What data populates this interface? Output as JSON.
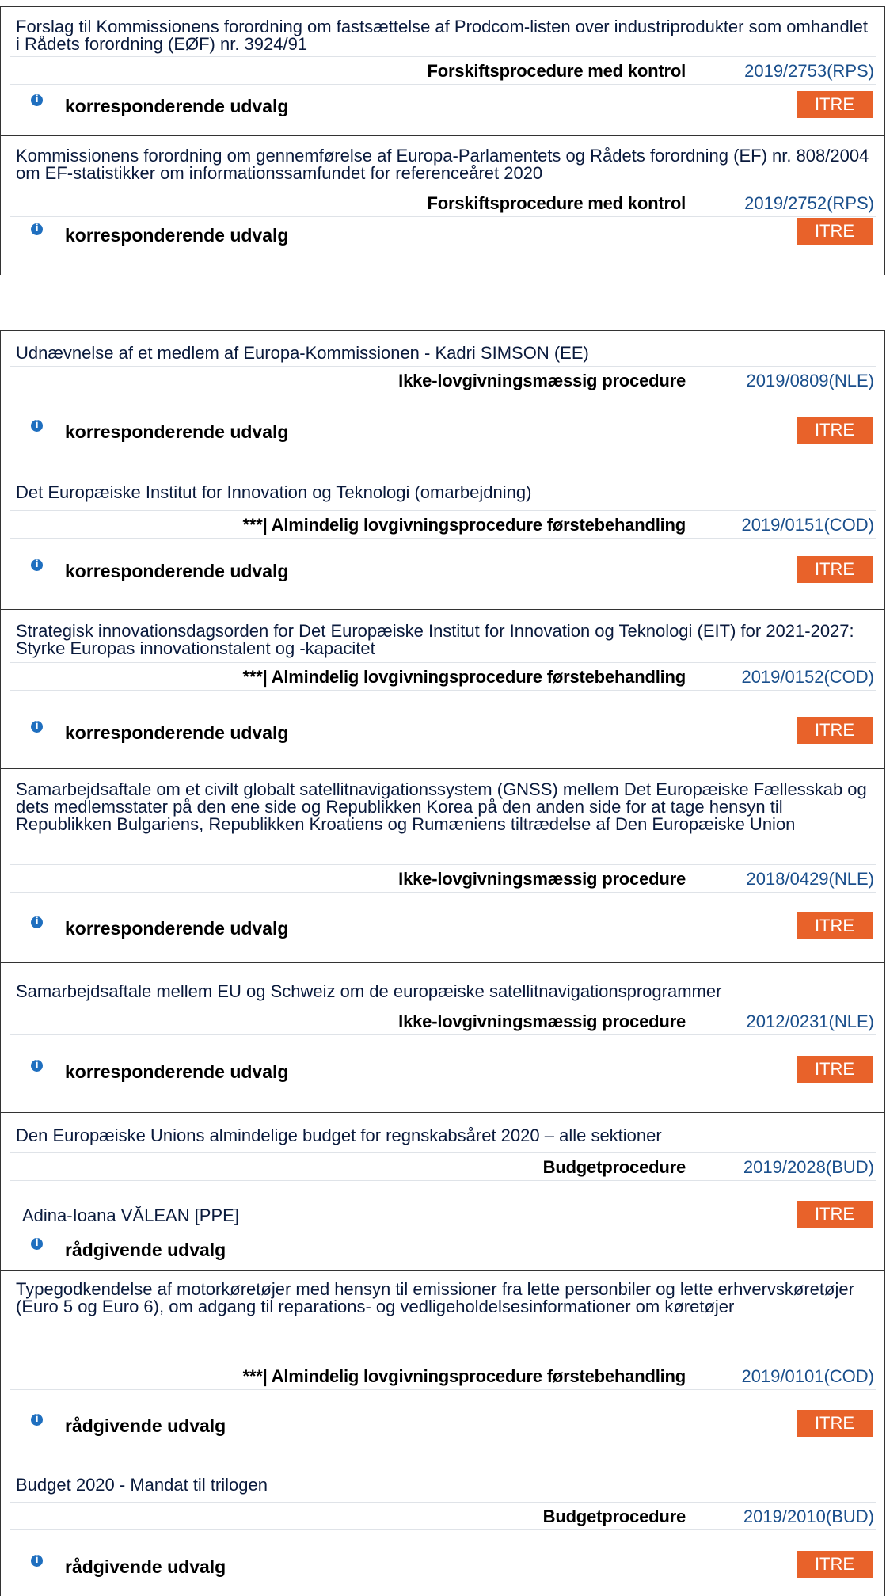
{
  "entries": [
    {
      "title": "Forslag til Kommissionens forordning om fastsættelse af Prodcom-listen over industriprodukter som omhandlet i Rådets forordning (EØF) nr. 3924/91",
      "procedure_type": "Forskiftsprocedure med kontrol",
      "procedure_ref": "2019/2753(RPS)",
      "rapporteur": "",
      "role": "korresponderende udvalg",
      "committee": "ITRE"
    },
    {
      "title": "Kommissionens forordning om gennemførelse af Europa-Parlamentets og Rådets forordning (EF) nr. 808/2004 om EF-statistikker om informationssamfundet for referenceåret 2020",
      "procedure_type": "Forskiftsprocedure med kontrol",
      "procedure_ref": "2019/2752(RPS)",
      "rapporteur": "",
      "role": "korresponderende udvalg",
      "committee": "ITRE"
    },
    {
      "title": "Udnævnelse af et medlem af Europa-Kommissionen - Kadri SIMSON  (EE)",
      "procedure_type": "Ikke-lovgivningsmæssig procedure",
      "procedure_ref": "2019/0809(NLE)",
      "rapporteur": "",
      "role": "korresponderende udvalg",
      "committee": "ITRE"
    },
    {
      "title": "Det Europæiske Institut for Innovation og Teknologi (omarbejdning)",
      "procedure_type": "***| Almindelig lovgivningsprocedure førstebehandling",
      "procedure_ref": "2019/0151(COD)",
      "rapporteur": "",
      "role": "korresponderende udvalg",
      "committee": "ITRE"
    },
    {
      "title": "Strategisk innovationsdagsorden for Det Europæiske Institut for Innovation og Teknologi (EIT) for 2021-2027: Styrke Europas innovationstalent og -kapacitet",
      "procedure_type": "***| Almindelig lovgivningsprocedure førstebehandling",
      "procedure_ref": "2019/0152(COD)",
      "rapporteur": "",
      "role": "korresponderende udvalg",
      "committee": "ITRE"
    },
    {
      "title": "Samarbejdsaftale om et civilt globalt satellitnavigationssystem (GNSS) mellem Det Europæiske Fællesskab og dets medlemsstater på den ene side og Republikken Korea på den anden side for at tage hensyn til Republikken Bulgariens, Republikken Kroatiens og Rumæniens tiltrædelse af Den Europæiske Union",
      "procedure_type": "Ikke-lovgivningsmæssig procedure",
      "procedure_ref": "2018/0429(NLE)",
      "rapporteur": "",
      "role": "korresponderende udvalg",
      "committee": "ITRE"
    },
    {
      "title": "Samarbejdsaftale mellem EU og Schweiz om de europæiske satellitnavigationsprogrammer",
      "procedure_type": "Ikke-lovgivningsmæssig procedure",
      "procedure_ref": "2012/0231(NLE)",
      "rapporteur": "",
      "role": "korresponderende udvalg",
      "committee": "ITRE"
    },
    {
      "title": "Den Europæiske Unions almindelige budget for regnskabsåret 2020 – alle sektioner",
      "procedure_type": "Budgetprocedure",
      "procedure_ref": "2019/2028(BUD)",
      "rapporteur": "Adina-Ioana VĂLEAN [PPE]",
      "role": "rådgivende udvalg",
      "committee": "ITRE"
    },
    {
      "title": "Typegodkendelse af motorkøretøjer med hensyn til emissioner fra lette personbiler og lette erhvervskøretøjer (Euro 5 og Euro 6), om adgang til reparations- og vedligeholdelsesinformationer om køretøjer",
      "procedure_type": "***| Almindelig lovgivningsprocedure førstebehandling",
      "procedure_ref": "2019/0101(COD)",
      "rapporteur": "",
      "role": "rådgivende udvalg",
      "committee": "ITRE"
    },
    {
      "title": "Budget 2020 - Mandat til trilogen",
      "procedure_type": "Budgetprocedure",
      "procedure_ref": "2019/2010(BUD)",
      "rapporteur": "",
      "role": "rådgivende udvalg",
      "committee": "ITRE"
    }
  ]
}
